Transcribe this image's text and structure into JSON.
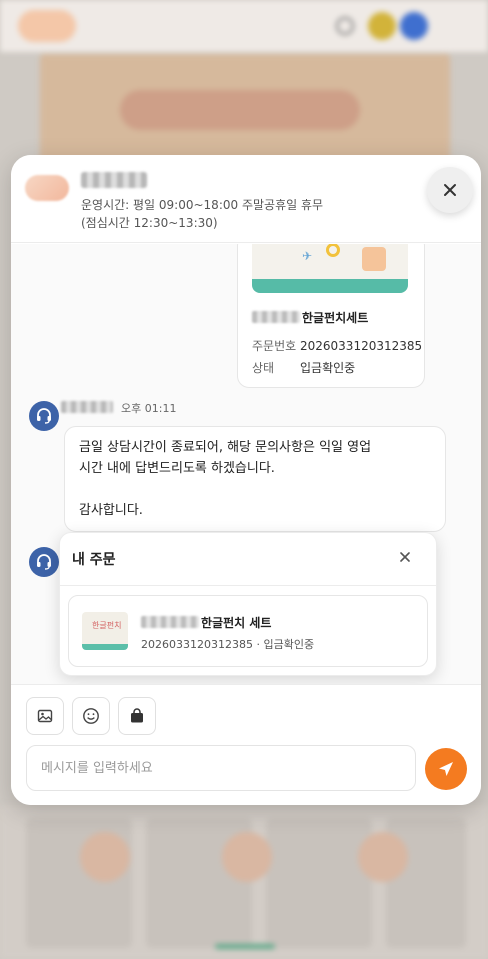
{
  "header": {
    "hours_text": "운영시간: 평일 09:00~18:00 주말공휴일 휴무",
    "lunch_text": "(점심시간 12:30~13:30)",
    "close_icon": "close-icon"
  },
  "product_card": {
    "name": "한글펀치세트",
    "order_label": "주문번호",
    "order_number": "2026033120312385",
    "status_label": "상태",
    "status_value": "입금확인중"
  },
  "message": {
    "time": "오후 01:11",
    "line1": "금일 상담시간이 종료되어, 해당 문의사항은 익일 영업",
    "line2": "시간 내에 답변드리도록 하겠습니다.",
    "line3": "감사합니다."
  },
  "order_popup": {
    "title": "내 주문",
    "item_name": "한글펀치 세트",
    "item_meta": "2026033120312385 · 입금확인중",
    "thumb_text": "한글펀치"
  },
  "composer": {
    "placeholder": "메시지를 입력하세요",
    "tools": [
      "image-icon",
      "emoji-icon",
      "bag-icon"
    ],
    "send_icon": "send-icon"
  },
  "colors": {
    "accent": "#f47b20",
    "agent": "#3d63a8"
  }
}
